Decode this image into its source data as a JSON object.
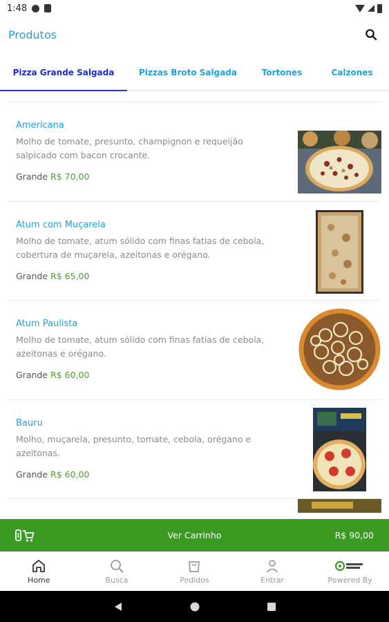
{
  "status_bar": {
    "time": "1:48"
  },
  "header": {
    "title": "Produtos"
  },
  "tabs": [
    {
      "label": "Pizza Grande Salgada",
      "active": true
    },
    {
      "label": "Pizzas Broto Salgada",
      "active": false
    },
    {
      "label": "Tortones",
      "active": false
    },
    {
      "label": "Calzones",
      "active": false
    }
  ],
  "products": [
    {
      "name": "Americana",
      "description": "Molho de tomate, presunto, champignon e requeijão salpicado com bacon crocante.",
      "size": "Grande",
      "price": "R$ 70,00"
    },
    {
      "name": "Atum com Muçarela",
      "description": "Molho de tomate, atum sólido com finas fatias de cebola, cobertura de muçarela, azeitonas e orégano.",
      "size": "Grande",
      "price": "R$ 65,00"
    },
    {
      "name": "Atum Paulista",
      "description": "Molho de tomate, atum sólido com finas fatias de cebola, azeitonas e orégano.",
      "size": "Grande",
      "price": "R$ 60,00"
    },
    {
      "name": "Bauru",
      "description": "Molho, muçarela, presunto, tomate, cebola, orégano e azeitonas.",
      "size": "Grande",
      "price": "R$ 60,00"
    }
  ],
  "cart": {
    "label": "Ver Carrinho",
    "total": "R$ 90,00"
  },
  "bottom_nav": [
    {
      "label": "Home",
      "icon": "home-icon",
      "active": true
    },
    {
      "label": "Busca",
      "icon": "search-icon",
      "active": false
    },
    {
      "label": "Pedidos",
      "icon": "bag-icon",
      "active": false
    },
    {
      "label": "Entrar",
      "icon": "user-icon",
      "active": false
    },
    {
      "label": "Powered By",
      "icon": "brand-logo",
      "active": false
    }
  ],
  "colors": {
    "accent": "#1ea3d8",
    "active_tab": "#1a2bd6",
    "price_green": "#4aa02c",
    "cart_bar": "#3a9a22"
  }
}
